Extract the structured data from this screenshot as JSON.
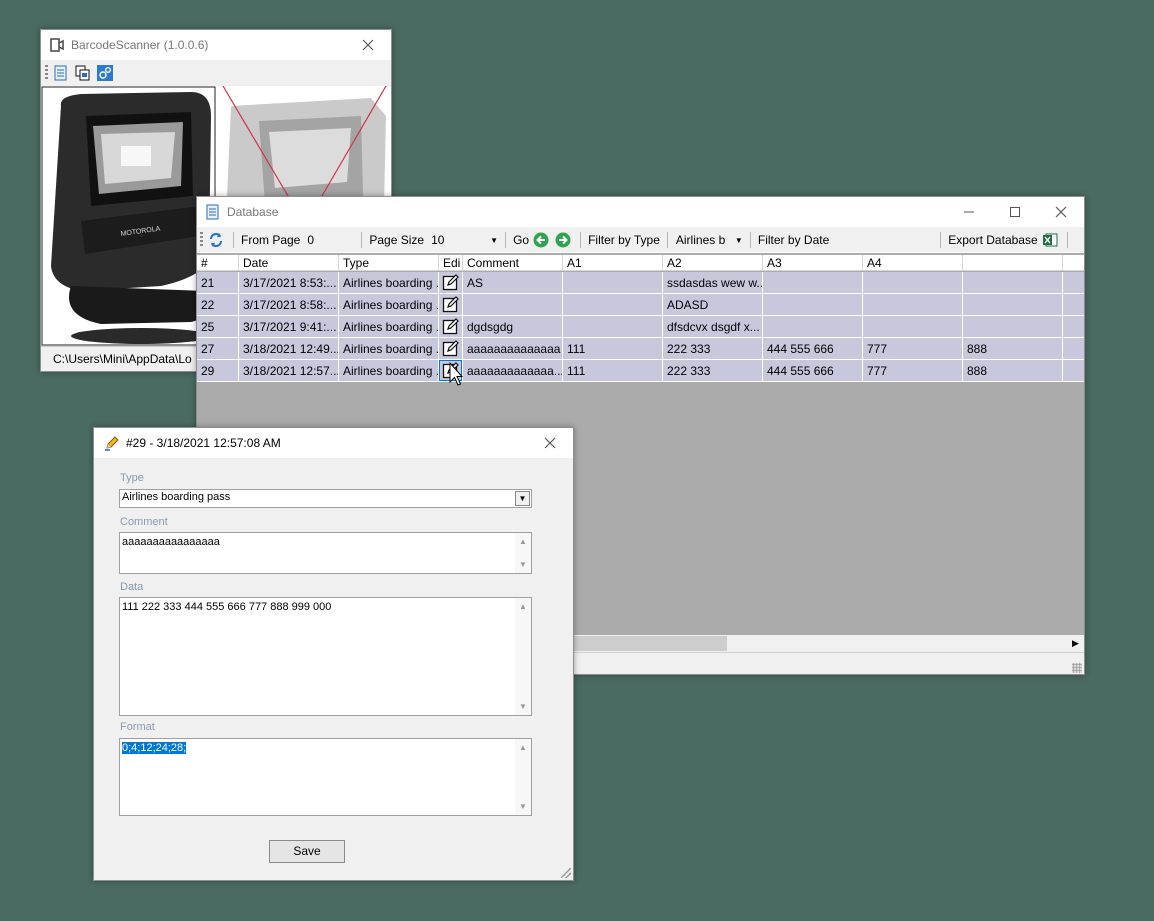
{
  "barcode_window": {
    "title": "BarcodeScanner (1.0.0.6)",
    "status_path": "C:\\Users\\Mini\\AppData\\Lo"
  },
  "database_window": {
    "title": "Database",
    "toolbar": {
      "from_page_label": "From Page",
      "from_page_value": "0",
      "page_size_label": "Page Size",
      "page_size_value": "10",
      "go_label": "Go",
      "filter_type_label": "Filter by Type",
      "filter_type_value": "Airlines b",
      "filter_date_label": "Filter by Date",
      "export_label": "Export Database"
    },
    "columns": [
      "#",
      "Date",
      "Type",
      "Edi",
      "Comment",
      "A1",
      "A2",
      "A3",
      "A4",
      ""
    ],
    "rows": [
      {
        "id": "21",
        "date": "3/17/2021 8:53:...",
        "type": "Airlines boarding ...",
        "comment": "AS",
        "a1": "",
        "a2": "ssdasdas wew w...",
        "a3": "",
        "a4": "",
        "a5": ""
      },
      {
        "id": "22",
        "date": "3/17/2021 8:58:...",
        "type": "Airlines boarding ...",
        "comment": "",
        "a1": "",
        "a2": "ADASD",
        "a3": "",
        "a4": "",
        "a5": ""
      },
      {
        "id": "25",
        "date": "3/17/2021 9:41:...",
        "type": "Airlines boarding ...",
        "comment": "dgdsgdg",
        "a1": "",
        "a2": "dfsdcvx  dsgdf  x...",
        "a3": "",
        "a4": "",
        "a5": ""
      },
      {
        "id": "27",
        "date": "3/18/2021 12:49...",
        "type": "Airlines boarding ...",
        "comment": "aaaaaaaaaaaaaa",
        "a1": "111",
        "a2": "222 333",
        "a3": "444 555 666",
        "a4": "777",
        "a5": "888"
      },
      {
        "id": "29",
        "date": "3/18/2021 12:57...",
        "type": "Airlines boarding ...",
        "comment": "aaaaaaaaaaaaa...",
        "a1": "111",
        "a2": "222 333",
        "a3": "444 555 666",
        "a4": "777",
        "a5": "888"
      }
    ]
  },
  "edit_dialog": {
    "title": "#29 - 3/18/2021 12:57:08 AM",
    "type_label": "Type",
    "type_value": "Airlines boarding pass",
    "comment_label": "Comment",
    "comment_value": "aaaaaaaaaaaaaaaa",
    "data_label": "Data",
    "data_value": "111 222 333 444 555 666 777 888 999 000",
    "format_label": "Format",
    "format_value": "0;4;12;24;28;",
    "save_label": "Save"
  },
  "colors": {
    "desktop": "#4a6b61",
    "row_bg": "#c8c8dc",
    "selection": "#0078d7"
  }
}
